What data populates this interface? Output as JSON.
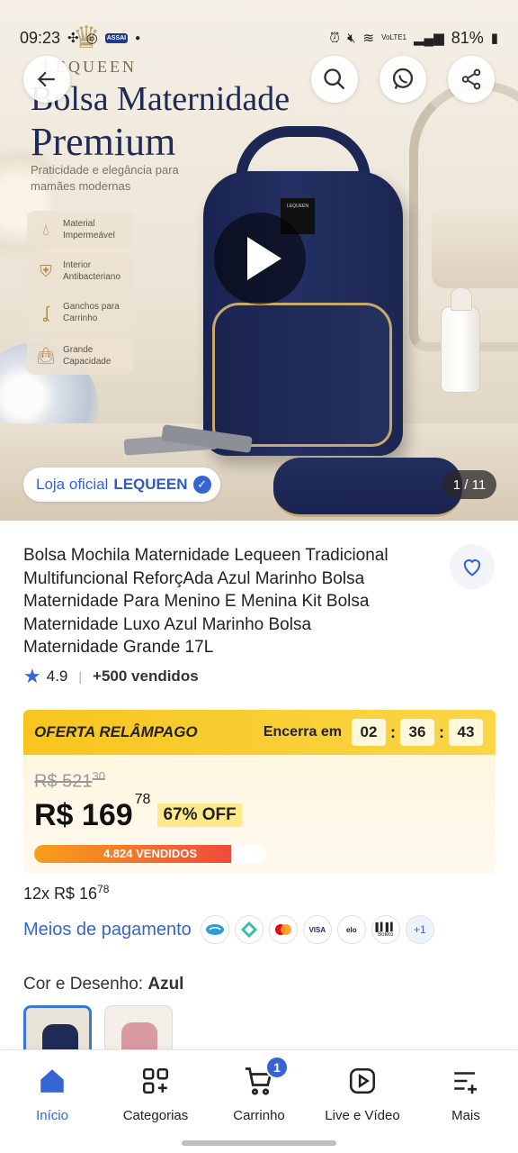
{
  "status_bar": {
    "time": "09:23",
    "app_badge": "ASSAI",
    "network": "VoLTE1",
    "battery": "81%"
  },
  "hero": {
    "brand": "LEQUEEN",
    "title_line1": "Bolsa Maternidade",
    "title_line2": "Premium",
    "tagline": "Praticidade e elegância para mamães modernas",
    "features": [
      {
        "label": "Material Impermeável",
        "icon": "drop-icon"
      },
      {
        "label": "Interior Antibacteriano",
        "icon": "shield-plus-icon"
      },
      {
        "label": "Ganchos para Carrinho",
        "icon": "hook-icon"
      },
      {
        "label": "Grande Capacidade",
        "icon": "bag-icon"
      }
    ],
    "bag_label": "LEQUEEN",
    "store_prefix": "Loja oficial",
    "store_name": "LEQUEEN",
    "image_counter": "1 / 11"
  },
  "product": {
    "title": "Bolsa Mochila Maternidade Lequeen Tradicional Multifuncional ReforçAda Azul Marinho Bolsa Maternidade Para Menino E Menina Kit Bolsa Maternidade Luxo Azul Marinho Bolsa Maternidade Grande 17L",
    "rating": "4.9",
    "sold": "+500 vendidos"
  },
  "flash": {
    "title": "OFERTA RELÂMPAGO",
    "ends_label": "Encerra em",
    "hours": "02",
    "minutes": "36",
    "seconds": "43",
    "old_price_main": "R$ 521",
    "old_price_cents": "30",
    "price_main": "R$ 169",
    "price_cents": "78",
    "discount": "67% OFF",
    "sold_text": "4.824 VENDIDOS",
    "sold_fraction": 0.85
  },
  "installments": {
    "main": "12x R$ 16",
    "cents": "78"
  },
  "payment": {
    "link": "Meios de pagamento",
    "methods": [
      "Mercado Pago",
      "Pix",
      "Mastercard",
      "VISA",
      "elo",
      "Boleto"
    ],
    "more": "+1"
  },
  "variants": {
    "label": "Cor e Desenho:",
    "selected": "Azul"
  },
  "bottom_nav": [
    {
      "label": "Início",
      "icon": "home-icon",
      "active": true
    },
    {
      "label": "Categorias",
      "icon": "categories-icon"
    },
    {
      "label": "Carrinho",
      "icon": "cart-icon",
      "badge": "1"
    },
    {
      "label": "Live e Vídeo",
      "icon": "play-video-icon"
    },
    {
      "label": "Mais",
      "icon": "menu-plus-icon"
    }
  ],
  "colors": {
    "accent": "#3565d0",
    "flash_yellow": "#f7c51e",
    "navy": "#1f2a55"
  }
}
